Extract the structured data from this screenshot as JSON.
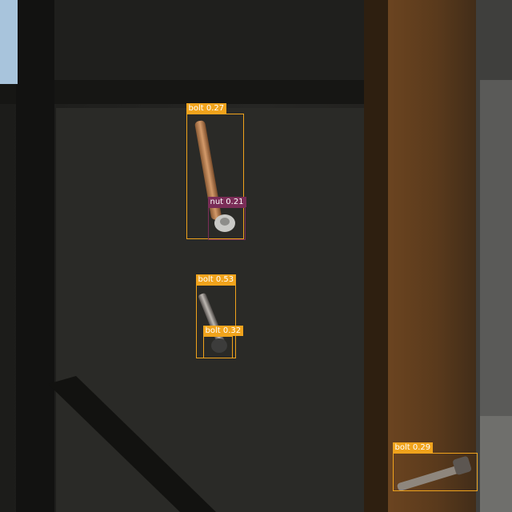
{
  "colors": {
    "bolt": "#f0a31c",
    "nut": "#7a2d57",
    "label_text": "#ffffff"
  },
  "detections": [
    {
      "id": "bolt-1",
      "class": "bolt",
      "confidence": "0.27",
      "label": "bolt  0.27"
    },
    {
      "id": "nut-1",
      "class": "nut",
      "confidence": "0.21",
      "label": "nut  0.21"
    },
    {
      "id": "bolt-2",
      "class": "bolt",
      "confidence": "0.53",
      "label": "bolt  0.53"
    },
    {
      "id": "bolt-3",
      "class": "bolt",
      "confidence": "0.32",
      "label": "bolt  0.32"
    },
    {
      "id": "bolt-4",
      "class": "bolt",
      "confidence": "0.29",
      "label": "bolt  0.29"
    }
  ]
}
